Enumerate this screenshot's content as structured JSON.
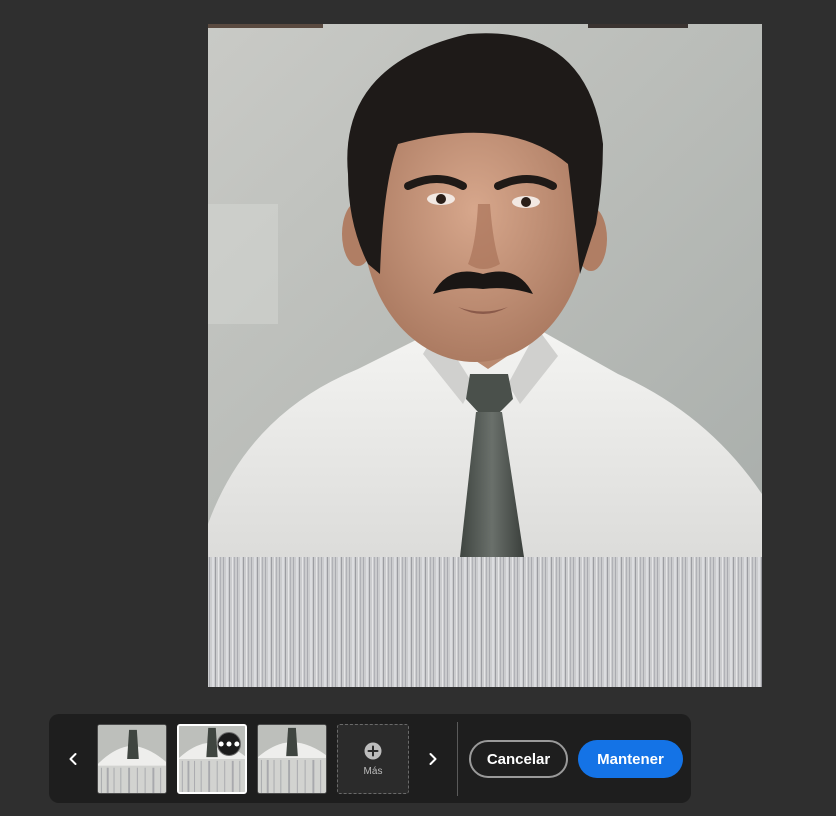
{
  "canvas": {
    "image_icon": "portrait-photo"
  },
  "taskbar": {
    "prev_icon": "chevron-left-icon",
    "next_icon": "chevron-right-icon",
    "variations": [
      {
        "name": "variation-1",
        "selected": false
      },
      {
        "name": "variation-2",
        "selected": true
      },
      {
        "name": "variation-3",
        "selected": false
      }
    ],
    "more_label": "Más",
    "cancel_label": "Cancelar",
    "keep_label": "Mantener"
  },
  "colors": {
    "background": "#2f2f2f",
    "taskbar": "#1e1e1e",
    "accent": "#1473e6"
  }
}
